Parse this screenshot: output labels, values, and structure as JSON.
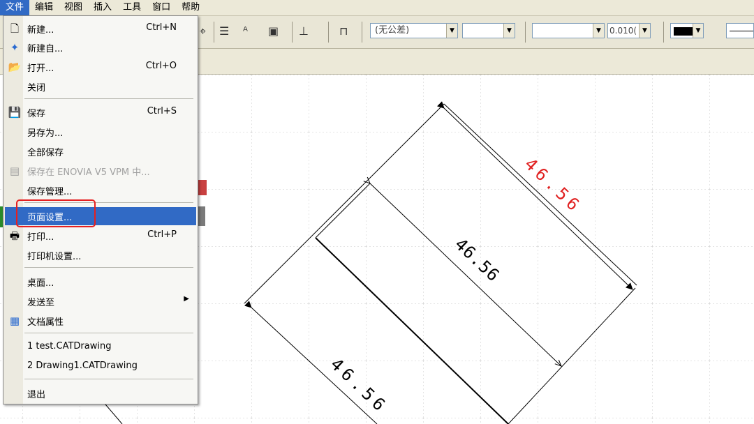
{
  "menubar": {
    "items": [
      "文件",
      "编辑",
      "视图",
      "插入",
      "工具",
      "窗口",
      "帮助"
    ]
  },
  "toolbar": {
    "tolerance_combo": "(无公差)",
    "precision_combo": "0.010(",
    "color_swatch": "#000000"
  },
  "file_menu": {
    "items": [
      {
        "label": "新建...",
        "shortcut": "Ctrl+N",
        "icon": "new-document-icon"
      },
      {
        "label": "新建自...",
        "shortcut": "",
        "icon": "new-from-icon"
      },
      {
        "label": "打开...",
        "shortcut": "Ctrl+O",
        "icon": "open-folder-icon"
      },
      {
        "label": "关闭",
        "shortcut": "",
        "icon": ""
      },
      {
        "label": "保存",
        "shortcut": "Ctrl+S",
        "icon": "save-icon"
      },
      {
        "label": "另存为...",
        "shortcut": "",
        "icon": ""
      },
      {
        "label": "全部保存",
        "shortcut": "",
        "icon": ""
      },
      {
        "label": "保存在 ENOVIA V5 VPM 中...",
        "shortcut": "",
        "icon": "enovia-save-icon",
        "disabled": true
      },
      {
        "label": "保存管理...",
        "shortcut": "",
        "icon": ""
      },
      {
        "label": "页面设置...",
        "shortcut": "",
        "icon": "",
        "highlighted": true
      },
      {
        "label": "打印...",
        "shortcut": "Ctrl+P",
        "icon": "printer-icon"
      },
      {
        "label": "打印机设置...",
        "shortcut": "",
        "icon": ""
      },
      {
        "label": "桌面...",
        "shortcut": "",
        "icon": ""
      },
      {
        "label": "发送至",
        "shortcut": "",
        "icon": "",
        "submenu": true
      },
      {
        "label": "文档属性",
        "shortcut": "",
        "icon": "properties-icon"
      },
      {
        "label": "1 test.CATDrawing",
        "shortcut": "",
        "icon": ""
      },
      {
        "label": "2 Drawing1.CATDrawing",
        "shortcut": "",
        "icon": ""
      },
      {
        "label": "退出",
        "shortcut": "",
        "icon": ""
      }
    ]
  },
  "drawing": {
    "dimension_red": "46.56",
    "dimension_middle": "46.56",
    "dimension_bottom": "46.56",
    "red_color": "#e02020"
  }
}
